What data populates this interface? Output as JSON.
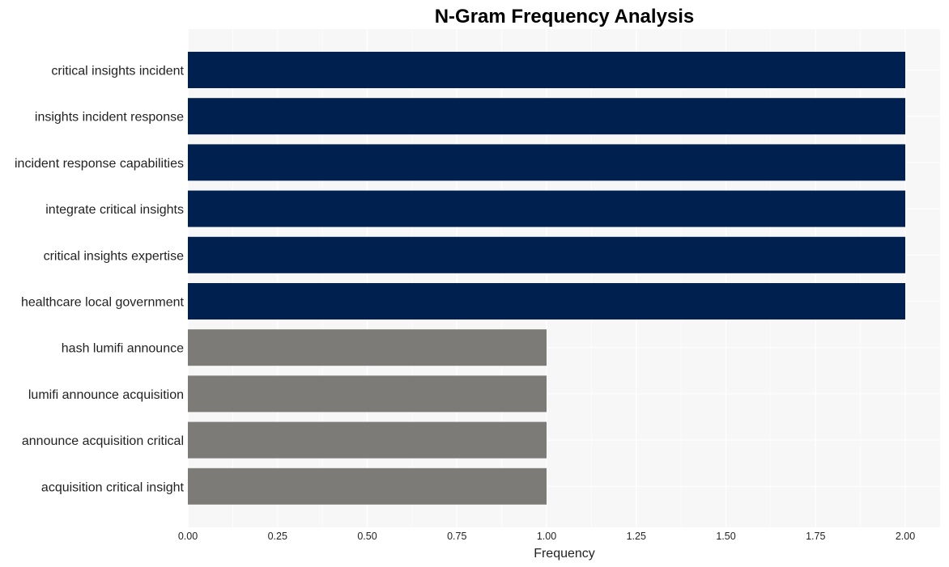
{
  "chart_data": {
    "type": "bar",
    "orientation": "horizontal",
    "title": "N-Gram Frequency Analysis",
    "xlabel": "Frequency",
    "ylabel": "",
    "xlim": [
      0,
      2.09
    ],
    "xticks": [
      0.0,
      0.25,
      0.5,
      0.75,
      1.0,
      1.25,
      1.5,
      1.75,
      2.0
    ],
    "xtick_labels": [
      "0.00",
      "0.25",
      "0.50",
      "0.75",
      "1.00",
      "1.25",
      "1.50",
      "1.75",
      "2.00"
    ],
    "grid": true,
    "categories": [
      "critical insights incident",
      "insights incident response",
      "incident response capabilities",
      "integrate critical insights",
      "critical insights expertise",
      "healthcare local government",
      "hash lumifi announce",
      "lumifi announce acquisition",
      "announce acquisition critical",
      "acquisition critical insight"
    ],
    "values": [
      2,
      2,
      2,
      2,
      2,
      2,
      1,
      1,
      1,
      1
    ],
    "colors": {
      "high": "#00204f",
      "low": "#7c7b77",
      "plot_background": "#f7f7f7",
      "grid": "#ffffff"
    }
  }
}
